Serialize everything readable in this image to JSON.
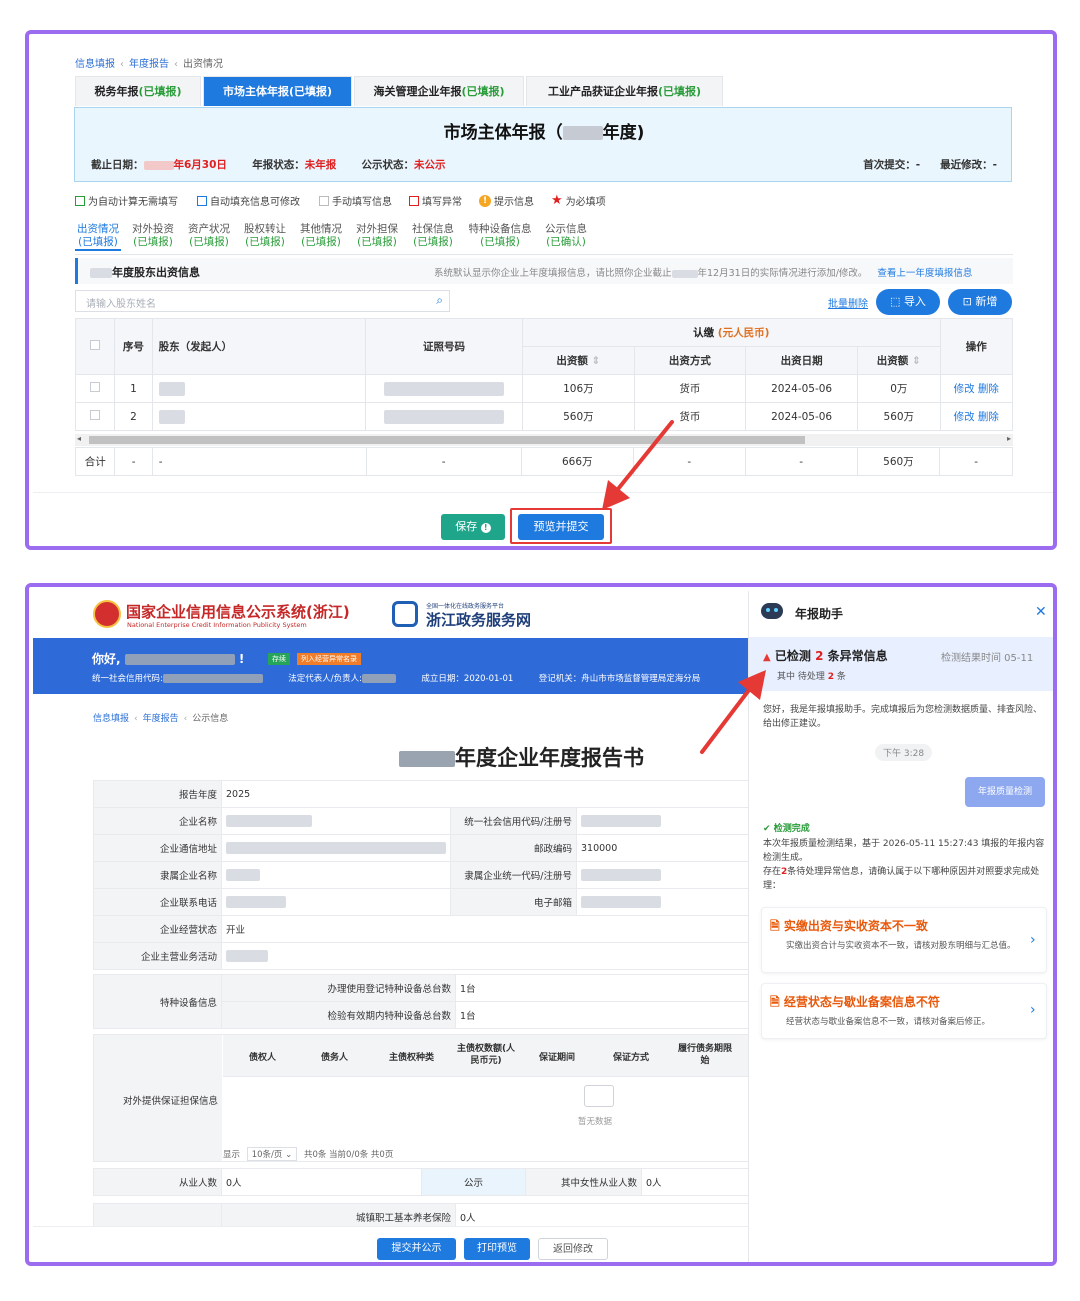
{
  "panel1": {
    "breadcrumb": [
      "信息填报",
      "年度报告",
      "出资情况"
    ],
    "top_tabs": [
      {
        "label": "税务年报",
        "status": "(已填报)"
      },
      {
        "label": "市场主体年报",
        "status": "(已填报)"
      },
      {
        "label": "海关管理企业年报",
        "status": "(已填报)"
      },
      {
        "label": "工业产品获证企业年报",
        "status": "(已填报)"
      }
    ],
    "report_title_prefix": "市场主体年报（",
    "report_title_suffix": "年度)",
    "deadline_label": "截止日期：",
    "deadline_value": "年6月30日",
    "report_status_label": "年报状态：",
    "report_status_value": "未年报",
    "publish_status_label": "公示状态：",
    "publish_status_value": "未公示",
    "first_submit": "首次提交：-",
    "last_modified": "最近修改：-",
    "legend": [
      "为自动计算无需填写",
      "自动填充信息可修改",
      "手动填写信息",
      "填写异常",
      "提示信息",
      "为必填项"
    ],
    "legend_colors": {
      "green": "#2a9d3a",
      "blue": "#1f7ae0",
      "grey": "#bbbbbb",
      "red": "#e02020",
      "orange": "#f5a623"
    },
    "sub_tabs": [
      {
        "label": "出资情况",
        "status": "(已填报)"
      },
      {
        "label": "对外投资",
        "status": "(已填报)"
      },
      {
        "label": "资产状况",
        "status": "(已填报)"
      },
      {
        "label": "股权转让",
        "status": "(已填报)"
      },
      {
        "label": "其他情况",
        "status": "(已填报)"
      },
      {
        "label": "对外担保",
        "status": "(已填报)"
      },
      {
        "label": "社保信息",
        "status": "(已填报)"
      },
      {
        "label": "特种设备信息",
        "status": "(已填报)"
      },
      {
        "label": "公示信息",
        "status": "(已确认)"
      }
    ],
    "section_title": "年度股东出资信息",
    "section_note": "系统默认显示你企业上年度填报信息，请比照你企业截止",
    "section_note2": "年12月31日的实际情况进行添加/修改。",
    "view_last_year": "查看上一年度填报信息",
    "search_placeholder": "请输入股东姓名",
    "bulk_delete": "批量删除",
    "import_label": "导入",
    "add_label": "新增",
    "table": {
      "h_index": "序号",
      "h_shareholder": "股东（发起人）",
      "h_id": "证照号码",
      "h_subscribed": "认缴（元人民币）",
      "h_amount": "出资额",
      "h_method": "出资方式",
      "h_date": "出资日期",
      "h_amount2": "出资额",
      "h_ops": "操作",
      "rows": [
        {
          "idx": "1",
          "amount": "106万",
          "method": "货币",
          "date": "2024-05-06",
          "amount2": "0万"
        },
        {
          "idx": "2",
          "amount": "560万",
          "method": "货币",
          "date": "2024-05-06",
          "amount2": "560万"
        }
      ],
      "edit": "修改",
      "delete": "删除",
      "total_label": "合计",
      "total_dash": "-",
      "total_amount": "666万",
      "total_amount2": "560万"
    },
    "save_label": "保存",
    "preview_submit_label": "预览并提交"
  },
  "panel2": {
    "site_title": "国家企业信用信息公示系统(浙江)",
    "site_subtitle": "National Enterprise Credit Information Publicity System",
    "gov_small": "全国一体化在线政务服务平台",
    "gov_title": "浙江政务服务网",
    "greeting": "你好,",
    "badge1": "存续",
    "badge2": "列入经营异常名录",
    "uscc_label": "统一社会信用代码:",
    "legal_label": "法定代表人/负责人:",
    "found_date": "成立日期：2020-01-01",
    "authority": "登记机关：舟山市市场监督管理局定海分局",
    "breadcrumb": [
      "信息填报",
      "年度报告",
      "公示信息"
    ],
    "doc_title": "年度企业年度报告书",
    "rows": {
      "report_year_label": "报告年度",
      "report_year": "2025",
      "company_name_label": "企业名称",
      "uscc_label": "统一社会信用代码/注册号",
      "address_label": "企业通信地址",
      "postcode_label": "邮政编码",
      "postcode": "310000",
      "parent_label": "隶属企业名称",
      "parent_code_label": "隶属企业统一代码/注册号",
      "phone_label": "企业联系电话",
      "email_label": "电子邮箱",
      "status_label": "企业经营状态",
      "status": "开业",
      "activity_label": "企业主营业务活动",
      "equip_label": "特种设备信息",
      "equip_reg_label": "办理使用登记特种设备总台数",
      "equip_reg": "1台",
      "equip_valid_label": "检验有效期内特种设备总台数",
      "equip_valid": "1台",
      "guarantee_label": "对外提供保证担保信息",
      "g_cols": [
        "债权人",
        "债务人",
        "主债权种类",
        "主债权数额(人民币元)",
        "保证期间",
        "保证方式",
        "履行债务期限始"
      ],
      "no_data": "暂无数据",
      "show": "显示",
      "per_page": "10条/页",
      "total_text": "共0条 当前0/0条 共0页",
      "staff_label": "从业人数",
      "staff": "0人",
      "publish": "公示",
      "female_label": "其中女性从业人数",
      "female": "0人",
      "pension_label": "城镇职工基本养老保险",
      "pension": "0人"
    },
    "btn_submit_publish": "提交并公示",
    "btn_print": "打印预览",
    "btn_back": "返回修改",
    "assistant": {
      "title": "年报助手",
      "alert_prefix": "已检测",
      "alert_count": "2",
      "alert_suffix": "条异常信息",
      "alert_time": "检测结果时间 05-11",
      "pending_prefix": "其中 待处理",
      "pending_count": "2",
      "pending_suffix": "条",
      "intro": "您好，我是年报填报助手。完成填报后为您检测数据质量、排查风险、给出修正建议。",
      "time": "下午 3:28",
      "user_msg": "年报质量检测",
      "done": "检测完成",
      "result1": "本次年报质量检测结果，基于 2026-05-11 15:27:43 填报的年报内容检测生成。",
      "result2_pre": "存在",
      "result2_count": "2",
      "result2_post": "条待处理异常信息，请确认属于以下哪种原因并对照要求完成处理：",
      "issues": [
        {
          "title": "实缴出资与实收资本不一致",
          "desc": "实缴出资合计与实收资本不一致，请核对股东明细与汇总值。"
        },
        {
          "title": "经营状态与歇业备案信息不符",
          "desc": "经营状态与歇业备案信息不一致，请核对备案后修正。"
        }
      ]
    }
  }
}
